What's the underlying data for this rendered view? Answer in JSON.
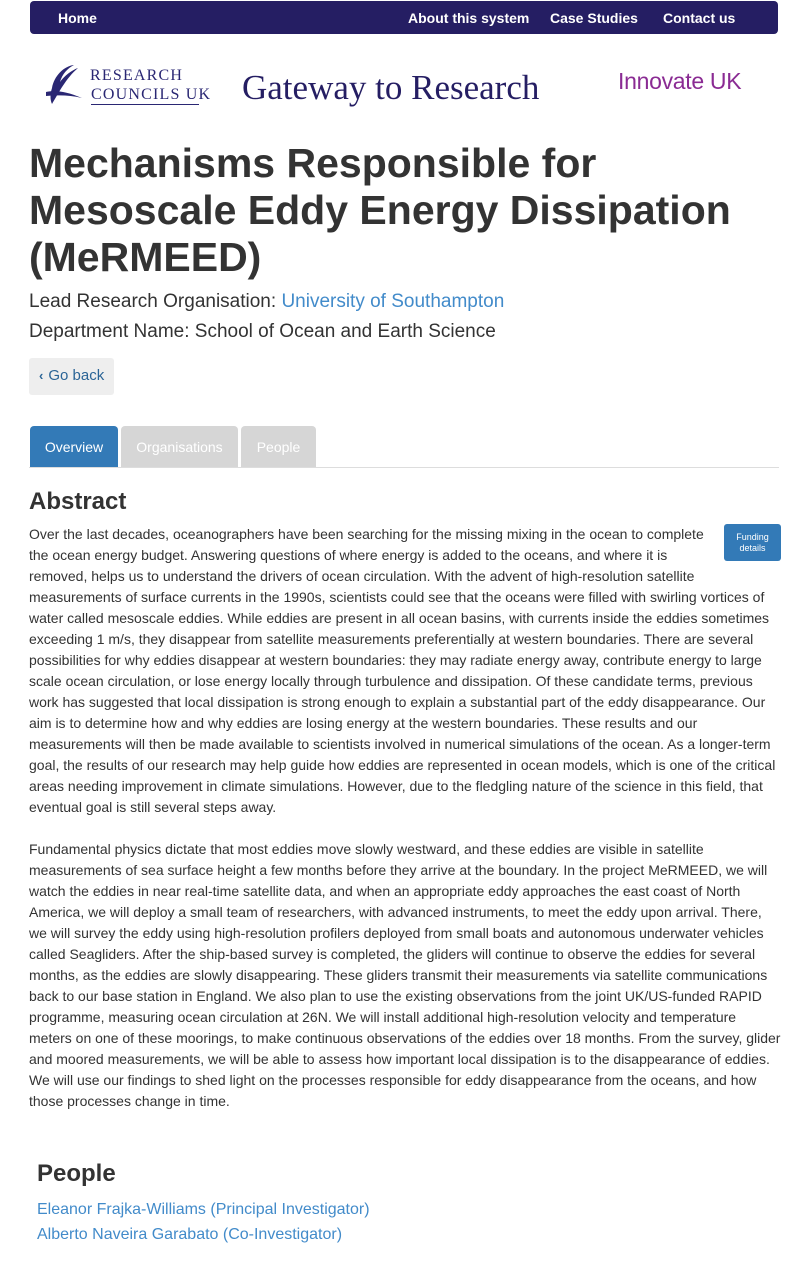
{
  "nav": {
    "home": "Home",
    "about": "About this system",
    "case_studies": "Case Studies",
    "contact": "Contact us"
  },
  "header": {
    "rcuk_line1": "RESEARCH",
    "rcuk_line2": "COUNCILS UK",
    "gateway_title": "Gateway to Research",
    "innovate": "Innovate UK"
  },
  "project": {
    "title": "Mechanisms Responsible for Mesoscale Eddy Energy Dissipation (MeRMEED)",
    "lead_org_label": "Lead Research Organisation: ",
    "lead_org": "University of Southampton",
    "department": "Department Name: School of Ocean and Earth Science"
  },
  "go_back": "Go back",
  "tabs": {
    "overview": "Overview",
    "organisations": "Organisations",
    "people": "People"
  },
  "abstract": {
    "heading": "Abstract",
    "funding_button": "Funding details",
    "paragraph1": "Over the last decades, oceanographers have been searching for the missing mixing in the ocean to complete the ocean energy budget. Answering questions of where energy is added to the oceans, and where it is removed, helps us to understand the drivers of ocean circulation. With the advent of high-resolution satellite measurements of surface currents in the 1990s, scientists could see that the oceans were filled with swirling vortices of water called mesoscale eddies. While eddies are present in all ocean basins, with currents inside the eddies sometimes exceeding 1 m/s, they disappear from satellite measurements preferentially at western boundaries. There are several possibilities for why eddies disappear at western boundaries: they may radiate energy away, contribute energy to large scale ocean circulation, or lose energy locally through turbulence and dissipation. Of these candidate terms, previous work has suggested that local dissipation is strong enough to explain a substantial part of the eddy disappearance. Our aim is to determine how and why eddies are losing energy at the western boundaries. These results and our measurements will then be made available to scientists involved in numerical simulations of the ocean. As a longer-term goal, the results of our research may help guide how eddies are represented in ocean models, which is one of the critical areas needing improvement in climate simulations. However, due to the fledgling nature of the science in this field, that eventual goal is still several steps away.",
    "paragraph2": "Fundamental physics dictate that most eddies move slowly westward, and these eddies are visible in satellite measurements of sea surface height a few months before they arrive at the boundary. In the project MeRMEED, we will watch the eddies in near real-time satellite data, and when an appropriate eddy approaches the east coast of North America, we will deploy a small team of researchers, with advanced instruments, to meet the eddy upon arrival. There, we will survey the eddy using high-resolution profilers deployed from small boats and autonomous underwater vehicles called Seagliders. After the ship-based survey is completed, the gliders will continue to observe the eddies for several months, as the eddies are slowly disappearing. These gliders transmit their measurements via satellite communications back to our base station in England. We also plan to use the existing observations from the joint UK/US-funded RAPID programme, measuring ocean circulation at 26N. We will install additional high-resolution velocity and temperature meters on one of these moorings, to make continuous observations of the eddies over 18 months. From the survey, glider and moored measurements, we will be able to assess how important local dissipation is to the disappearance of eddies. We will use our findings to shed light on the processes responsible for eddy disappearance from the oceans, and how those processes change in time."
  },
  "people": {
    "heading": "People",
    "items": [
      "Eleanor Frajka-Williams (Principal Investigator)",
      "Alberto Naveira Garabato (Co-Investigator)"
    ]
  },
  "colors": {
    "navbar": "#251e63",
    "link": "#428bca",
    "active_tab": "#337ab7",
    "inactive_tab": "#d6d6d6",
    "innovate": "#8a2b93"
  }
}
